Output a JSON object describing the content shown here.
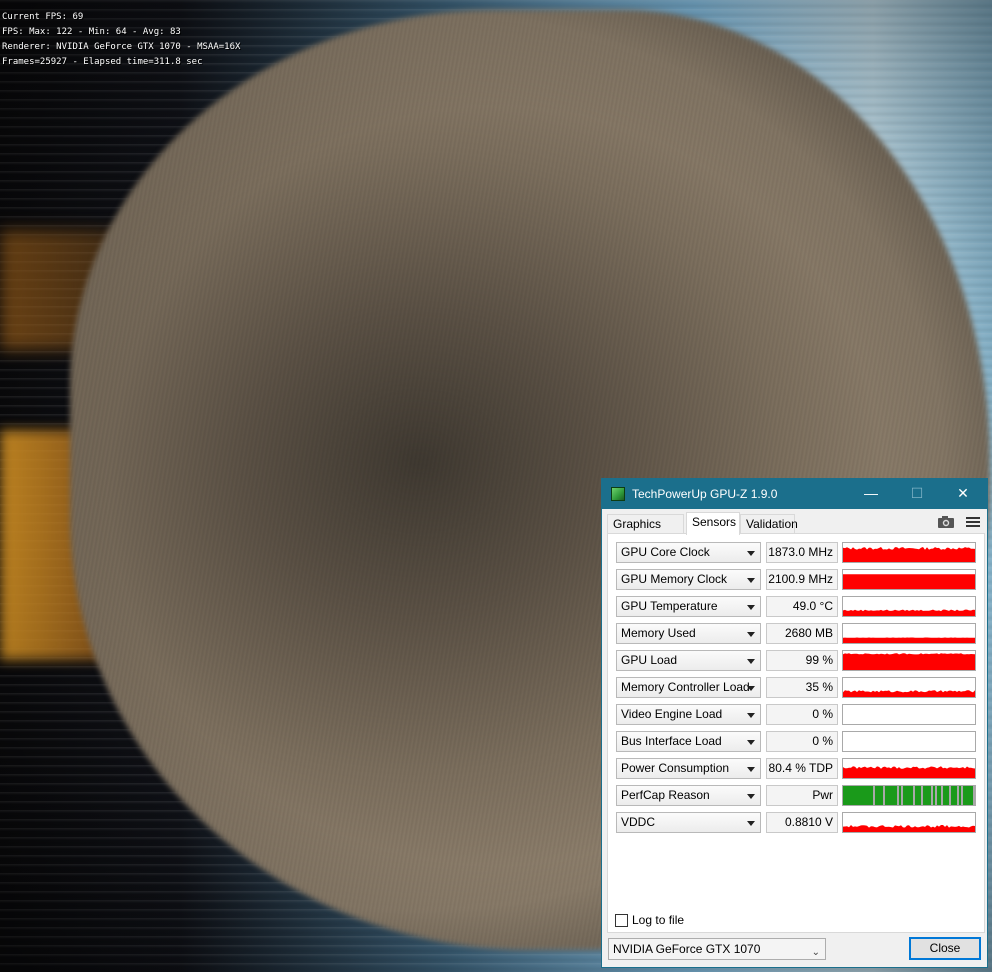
{
  "overlay": {
    "lines": [
      "Current FPS: 69",
      "FPS: Max: 122 - Min: 64 - Avg: 83",
      "Renderer: NVIDIA GeForce GTX 1070 - MSAA=16X",
      "Frames=25927 - Elapsed time=311.8 sec"
    ]
  },
  "window": {
    "title": "TechPowerUp GPU-Z 1.9.0",
    "controls": {
      "minimize": "—",
      "maximize": "☐",
      "close": "✕"
    },
    "tabs": [
      {
        "label": "Graphics Card",
        "active": false
      },
      {
        "label": "Sensors",
        "active": true
      },
      {
        "label": "Validation",
        "active": false
      }
    ],
    "icons": {
      "camera": "camera-icon",
      "menu": "hamburger-menu-icon"
    }
  },
  "colors": {
    "title_bar": "#1b6f8c",
    "graph_red": "#ff0000",
    "graph_green": "#1a9a1a",
    "graph_gray": "#a8a8a8",
    "focus_blue": "#0078d7"
  },
  "sensors": [
    {
      "name": "GPU Core Clock",
      "value": "1873.0 MHz",
      "graph": {
        "color": "red",
        "level": 0.72,
        "noise": 0.15
      }
    },
    {
      "name": "GPU Memory Clock",
      "value": "2100.9 MHz",
      "graph": {
        "color": "red",
        "level": 0.78,
        "noise": 0.0
      }
    },
    {
      "name": "GPU Temperature",
      "value": "49.0 °C",
      "graph": {
        "color": "red",
        "level": 0.3,
        "noise": 0.08
      }
    },
    {
      "name": "Memory Used",
      "value": "2680 MB",
      "graph": {
        "color": "red",
        "level": 0.28,
        "noise": 0.02
      }
    },
    {
      "name": "GPU Load",
      "value": "99 %",
      "graph": {
        "color": "red",
        "level": 0.85,
        "noise": 0.06
      }
    },
    {
      "name": "Memory Controller Load",
      "value": "35 %",
      "graph": {
        "color": "red",
        "level": 0.3,
        "noise": 0.12
      }
    },
    {
      "name": "Video Engine Load",
      "value": "0 %",
      "graph": {
        "color": "red",
        "level": 0.0,
        "noise": 0.0
      }
    },
    {
      "name": "Bus Interface Load",
      "value": "0 %",
      "graph": {
        "color": "red",
        "level": 0.0,
        "noise": 0.0
      }
    },
    {
      "name": "Power Consumption",
      "value": "80.4 % TDP",
      "graph": {
        "color": "red",
        "level": 0.55,
        "noise": 0.14
      }
    },
    {
      "name": "PerfCap Reason",
      "value": "Pwr",
      "graph": {
        "color": "perfcap",
        "level": 1.0,
        "noise": 0.0
      }
    },
    {
      "name": "VDDC",
      "value": "0.8810 V",
      "graph": {
        "color": "red",
        "level": 0.3,
        "noise": 0.14
      }
    }
  ],
  "footer": {
    "log_to_file_label": "Log to file",
    "log_to_file_checked": false,
    "gpu_selected": "NVIDIA GeForce GTX 1070",
    "close_label": "Close"
  }
}
